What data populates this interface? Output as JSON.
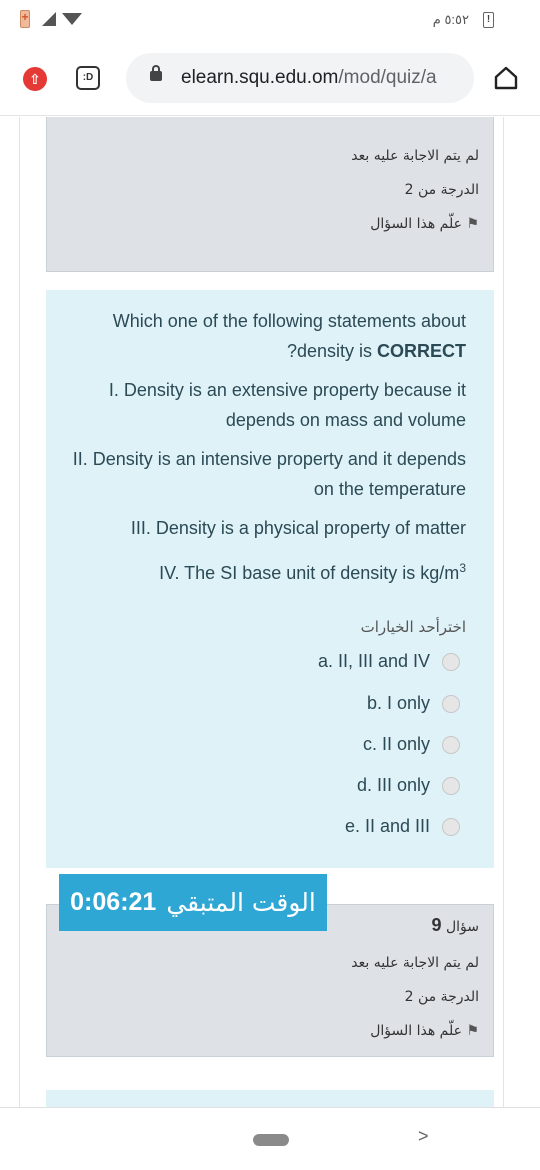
{
  "status_bar": {
    "time": "٥:٥٢ م",
    "icons": [
      "battery-saver-icon",
      "signal-icon",
      "wifi-icon",
      "alert-icon"
    ]
  },
  "browser": {
    "url_host": "elearn.squ.edu.om",
    "url_path": "/mod/quiz/a",
    "ext_label": ":D",
    "icons": [
      "upload-icon",
      "extension-icon",
      "lock-icon",
      "home-icon"
    ]
  },
  "previous_question_info": {
    "status": "لم يتم الاجابة عليه بعد",
    "grade": "الدرجة من 2",
    "flag_label": "علّم هذا السؤال"
  },
  "question": {
    "text_line1": "Which one of the following statements about",
    "text_line2_prefix": "?density is ",
    "text_line2_bold": "CORRECT",
    "statements": [
      "I. Density is an extensive property because it depends on mass and volume",
      "II. Density is an intensive property and it depends on the temperature",
      "III. Density is a physical property of matter",
      "IV. The SI base unit of density is kg/m"
    ],
    "superscript": "3",
    "prompt": "اخترأحد الخيارات",
    "options": [
      {
        "label": "a. II, III and IV",
        "selected": false
      },
      {
        "label": "b. I only",
        "selected": false
      },
      {
        "label": "c. II only",
        "selected": false
      },
      {
        "label": "d. III only",
        "selected": false
      },
      {
        "label": "e. II and III",
        "selected": false
      }
    ]
  },
  "next_question_info": {
    "qno_label": "سؤال",
    "qno": "9",
    "status": "لم يتم الاجابة عليه بعد",
    "grade": "الدرجة من 2",
    "flag_label": "علّم هذا السؤال"
  },
  "timer": {
    "label": "الوقت المتبقي",
    "value": "0:06:21",
    "color": "#2ea7d4"
  },
  "nav": {
    "back_glyph": ">"
  }
}
